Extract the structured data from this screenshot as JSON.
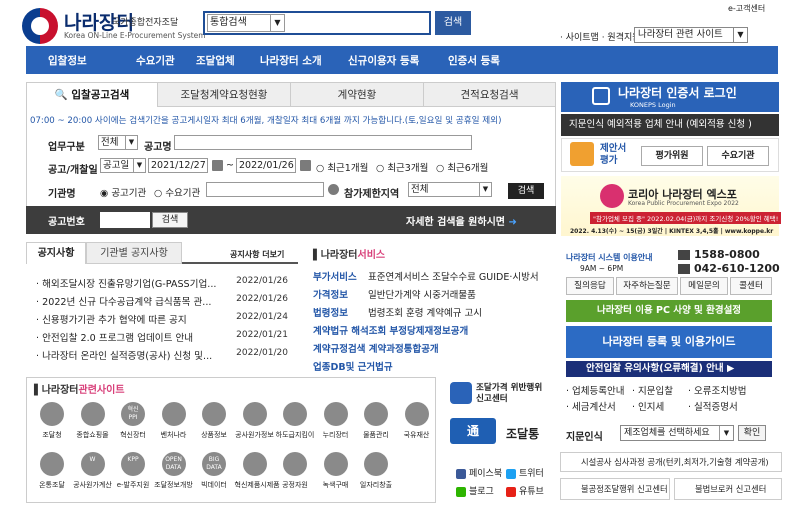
{
  "header": {
    "logo_title": "나라장터",
    "logo_subtitle": "국가종합전자조달",
    "logo_english": "Korea ON-Line E-Procurement System",
    "search_select": "통합검색",
    "search_button": "검색",
    "ecenter": "e-고객센터",
    "sitemap_label": "· 사이트맵 · 원격지원",
    "site_select": "나라장터 관련 사이트"
  },
  "nav": [
    "입찰정보",
    "수요기관",
    "조달업체",
    "나라장터 소개",
    "신규이용자 등록",
    "인증서 등록"
  ],
  "search_tabs": [
    "입찰공고검색",
    "조달청계약요청현황",
    "계약현황",
    "견적요청검색"
  ],
  "search_form": {
    "notice": "07:00 ~ 20:00 사이에는 검색기간을 공고게시일자 최대 6개월, 개찰일자 최대 6개월 까지 가능합니다.(토,일요일 및 공휴일 제외)",
    "work_type_label": "업무구분",
    "work_type_value": "전체",
    "notice_name_label": "공고명",
    "date_label": "공고/개찰일",
    "date_type_value": "공고일",
    "date_from": "2021/12/27",
    "date_to": "2022/01/26",
    "tilde": "~",
    "period_options": [
      "최근1개월",
      "최근3개월",
      "최근6개월"
    ],
    "agency_label": "기관명",
    "agency_options": [
      "공고기관",
      "수요기관"
    ],
    "region_label": "참가제한지역",
    "region_value": "전체",
    "go_button": "검색",
    "bid_no_label": "공고번호",
    "bid_no_button": "검색",
    "detail_search": "자세한 검색을 원하시면"
  },
  "notices": {
    "tab_active": "공지사항",
    "tab_other": "기관별 공지사항",
    "more": "공지사항 더보기",
    "items": [
      {
        "title": "해외조달시장 진출유망기업(G-PASS기업...",
        "date": "2022/01/26"
      },
      {
        "title": "2022년 신규 다수공급계약 급식품목 관...",
        "date": "2022/01/26"
      },
      {
        "title": "신용평가기관 추가 협약에 따른 공지",
        "date": "2022/01/24"
      },
      {
        "title": "안전입찰 2.0 프로그램 업데이트 안내",
        "date": "2022/01/21"
      },
      {
        "title": "나라장터 온라인 실적증명(공사) 신청 및...",
        "date": "2022/01/20"
      }
    ]
  },
  "services": {
    "title_prefix": "나라장터",
    "title_accent": "서비스",
    "rows": [
      {
        "cat": "부가서비스",
        "text": "표준연계서비스 조달수수료 GUIDE·시방서"
      },
      {
        "cat": "가격정보",
        "text": "일반단가계약 시중거래물품"
      },
      {
        "cat": "법령정보",
        "text": "법령조회  훈령  계약예규  고시"
      },
      {
        "cat": "",
        "text": "계약법규 해석조회  부정당제재정보공개"
      },
      {
        "cat": "",
        "text": "계약규정검색  계약과정통합공개"
      },
      {
        "cat": "",
        "text": "업종DB및 근거법규"
      }
    ]
  },
  "related": {
    "title_prefix": "나라장터",
    "title_accent": "관련사이트",
    "row1": [
      "조달청",
      "종합쇼핑몰",
      "혁신장터",
      "벤처나라",
      "상품정보",
      "공사원가정보",
      "하도급지킴이",
      "누리장터",
      "물품관리",
      "국유재산"
    ],
    "row2": [
      "온통조달",
      "공사원가계산",
      "e-발주지원",
      "조달정보개방",
      "빅데이터",
      "혁신제품시제품",
      "공정자원",
      "녹색구매",
      "일자리창출"
    ],
    "row1_icon_text": [
      "",
      "",
      "혁신\nPPI",
      "",
      "",
      "",
      "",
      "",
      "",
      ""
    ],
    "row2_icon_text": [
      "",
      "W",
      "KPP",
      "OPEN\nDATA",
      "BIG\nDATA",
      "",
      "",
      "",
      ""
    ]
  },
  "middle_right": {
    "report_title": "조달가격 위반행위\n신고센터",
    "tong_icon": "通",
    "tong_text": "조달통",
    "facebook": "페이스북",
    "twitter": "트위터",
    "blog": "블로그",
    "youtube": "유튜브"
  },
  "right": {
    "login_title": "나라장터 인증서 로그인",
    "login_sub": "KONEPS Login",
    "fingerprint": "지문인식 예외적용 업체 안내 (예외적용 신청 )",
    "proposal": "제안서\n평가",
    "eval_buttons": [
      "평가위원",
      "수요기관"
    ],
    "expo_title": "코리아 나라장터 엑스포",
    "expo_en": "Korea Public Procurement Expo 2022",
    "expo_tag": "\"참가업체 모집 중\" 2022.02.04(금)까지 조기신청 20%할인 혜택!",
    "expo_info": "2022. 4.13(수) ~ 15(금) 3일간 | KINTEX 3,4,5홀 | www.koppe.kr",
    "help_title": "나라장터 시스템 이용안내",
    "help_hours": "9AM ~ 6PM",
    "phone1": "1588-0800",
    "phone2": "042-610-1200",
    "help_buttons": [
      "질의응답",
      "자주하는질문",
      "메일문의",
      "콜센터"
    ],
    "pcspec": "나라장터 이용 PC 사양 및 환경설정",
    "regguide": "나라장터 등록 및 이용가이드",
    "notice_guide": "안전입찰 유의사항(오류해결) 안내 ▶",
    "links_row1": [
      "· 업체등록안내",
      "· 지문입찰",
      "· 오류조치방법"
    ],
    "links_row2": [
      "· 세금계산서",
      "· 인지세",
      "· 실적증명서"
    ],
    "fp_label": "지문인식",
    "fp_select": "제조업체를 선택하세요",
    "fp_button": "확인",
    "facility": "시설공사 심사과정 공개(턴키,최저가,기술형 계약공개)",
    "bottom_buttons": [
      "불공정조달행위 신고센터",
      "불법브로커 신고센터"
    ]
  },
  "colors": {
    "nav": "#2a63b8",
    "accent_pink": "#d8407a",
    "link_blue": "#2457a8"
  }
}
